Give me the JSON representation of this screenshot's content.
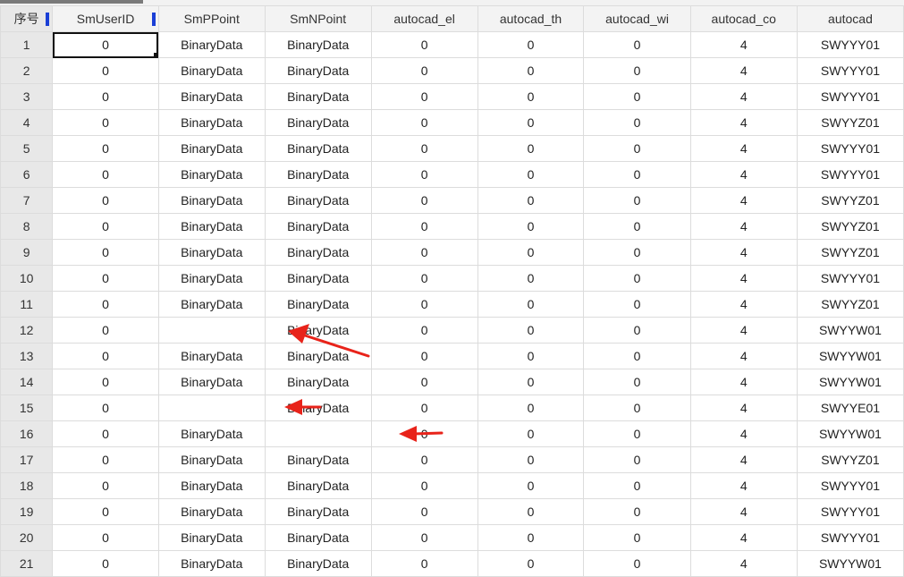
{
  "columns": [
    "序号",
    "SmUserID",
    "SmPPoint",
    "SmNPoint",
    "autocad_el",
    "autocad_th",
    "autocad_wi",
    "autocad_co",
    "autocad"
  ],
  "rows": [
    [
      "1",
      "0",
      "BinaryData",
      "BinaryData",
      "0",
      "0",
      "0",
      "4",
      "SWYYY01"
    ],
    [
      "2",
      "0",
      "BinaryData",
      "BinaryData",
      "0",
      "0",
      "0",
      "4",
      "SWYYY01"
    ],
    [
      "3",
      "0",
      "BinaryData",
      "BinaryData",
      "0",
      "0",
      "0",
      "4",
      "SWYYY01"
    ],
    [
      "4",
      "0",
      "BinaryData",
      "BinaryData",
      "0",
      "0",
      "0",
      "4",
      "SWYYZ01"
    ],
    [
      "5",
      "0",
      "BinaryData",
      "BinaryData",
      "0",
      "0",
      "0",
      "4",
      "SWYYY01"
    ],
    [
      "6",
      "0",
      "BinaryData",
      "BinaryData",
      "0",
      "0",
      "0",
      "4",
      "SWYYY01"
    ],
    [
      "7",
      "0",
      "BinaryData",
      "BinaryData",
      "0",
      "0",
      "0",
      "4",
      "SWYYZ01"
    ],
    [
      "8",
      "0",
      "BinaryData",
      "BinaryData",
      "0",
      "0",
      "0",
      "4",
      "SWYYZ01"
    ],
    [
      "9",
      "0",
      "BinaryData",
      "BinaryData",
      "0",
      "0",
      "0",
      "4",
      "SWYYZ01"
    ],
    [
      "10",
      "0",
      "BinaryData",
      "BinaryData",
      "0",
      "0",
      "0",
      "4",
      "SWYYY01"
    ],
    [
      "11",
      "0",
      "BinaryData",
      "BinaryData",
      "0",
      "0",
      "0",
      "4",
      "SWYYZ01"
    ],
    [
      "12",
      "0",
      "",
      "BinaryData",
      "0",
      "0",
      "0",
      "4",
      "SWYYW01"
    ],
    [
      "13",
      "0",
      "BinaryData",
      "BinaryData",
      "0",
      "0",
      "0",
      "4",
      "SWYYW01"
    ],
    [
      "14",
      "0",
      "BinaryData",
      "BinaryData",
      "0",
      "0",
      "0",
      "4",
      "SWYYW01"
    ],
    [
      "15",
      "0",
      "",
      "BinaryData",
      "0",
      "0",
      "0",
      "4",
      "SWYYE01"
    ],
    [
      "16",
      "0",
      "BinaryData",
      "",
      "0",
      "0",
      "0",
      "4",
      "SWYYW01"
    ],
    [
      "17",
      "0",
      "BinaryData",
      "BinaryData",
      "0",
      "0",
      "0",
      "4",
      "SWYYZ01"
    ],
    [
      "18",
      "0",
      "BinaryData",
      "BinaryData",
      "0",
      "0",
      "0",
      "4",
      "SWYYY01"
    ],
    [
      "19",
      "0",
      "BinaryData",
      "BinaryData",
      "0",
      "0",
      "0",
      "4",
      "SWYYY01"
    ],
    [
      "20",
      "0",
      "BinaryData",
      "BinaryData",
      "0",
      "0",
      "0",
      "4",
      "SWYYY01"
    ],
    [
      "21",
      "0",
      "BinaryData",
      "BinaryData",
      "0",
      "0",
      "0",
      "4",
      "SWYYW01"
    ]
  ],
  "annotations": {
    "arrow_color": "#e8231a",
    "targets": [
      "row-12-SmPPoint",
      "row-15-SmPPoint",
      "row-16-SmNPoint"
    ]
  },
  "colors": {
    "column_marker": "#1a3fd6",
    "index_bg": "#e8e8e8",
    "header_bg": "#f3f3f3"
  }
}
